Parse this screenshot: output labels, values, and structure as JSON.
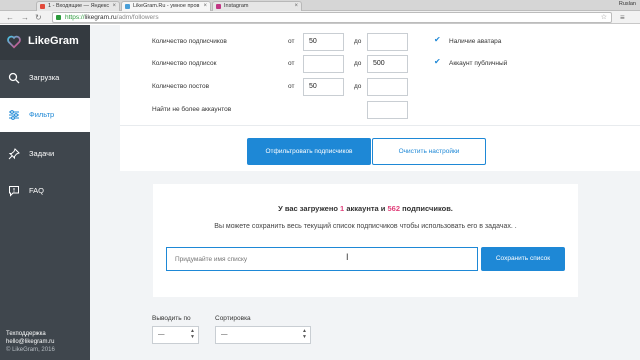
{
  "browser": {
    "tabs": [
      {
        "title": "1 - Входящие — Яндекс",
        "favicon_color": "#e24a3b"
      },
      {
        "title": "LikeGram.Ru - умное пров",
        "favicon_color": "#4a9fd8"
      },
      {
        "title": "Instagram",
        "favicon_color": "#c13584"
      }
    ],
    "user": "Ruslan",
    "url_scheme": "https://",
    "url_host": "likegram.ru",
    "url_path": "/adm/followers"
  },
  "sidebar": {
    "app_name": "LikeGram",
    "items": [
      {
        "label": "Загрузка",
        "icon": "search-icon",
        "active": false
      },
      {
        "label": "Фильтр",
        "icon": "sliders-icon",
        "active": true
      },
      {
        "label": "Задачи",
        "icon": "pin-icon",
        "active": false
      },
      {
        "label": "FAQ",
        "icon": "comment-icon",
        "active": false
      }
    ],
    "support_title": "Техподдержка",
    "support_email": "hello@likegram.ru",
    "copyright": "© LikeGram, 2016"
  },
  "filters": {
    "rows": [
      {
        "label": "Количество подписчиков",
        "from_label": "от",
        "from_value": "50",
        "to_label": "до",
        "to_value": ""
      },
      {
        "label": "Количество подписок",
        "from_label": "от",
        "from_value": "",
        "to_label": "до",
        "to_value": "500"
      },
      {
        "label": "Количество постов",
        "from_label": "от",
        "from_value": "50",
        "to_label": "до",
        "to_value": ""
      },
      {
        "label": "Найти не более аккаунтов",
        "to_value": ""
      }
    ],
    "checkboxes": [
      {
        "label": "Наличие аватара",
        "checked": true
      },
      {
        "label": "Аккаунт публичный",
        "checked": true
      }
    ],
    "apply_button": "Отфильтровать подписчиков",
    "reset_button": "Очистить настройки"
  },
  "save": {
    "loaded_prefix": "У вас загружено",
    "accounts_count": "1",
    "accounts_word": "аккаунта и",
    "followers_count": "562",
    "followers_word": "подписчиков.",
    "hint": "Вы можете сохранить весь текущий список подписчиков чтобы использовать его в задачах. .",
    "input_placeholder": "Придумайте имя списку",
    "save_button": "Сохранить список"
  },
  "output": {
    "show_label": "Выводить по",
    "show_value": "—",
    "sort_label": "Сортировка",
    "sort_value": "—"
  },
  "colors": {
    "accent": "#1e88d6",
    "highlight": "#e0407a",
    "sidebar_bg": "#3f464d"
  }
}
